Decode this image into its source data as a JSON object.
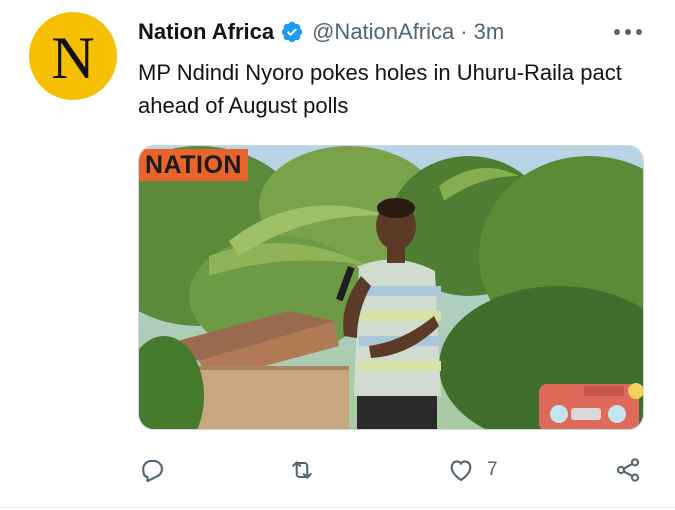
{
  "tweet": {
    "avatar_letter": "N",
    "display_name": "Nation Africa",
    "handle": "@NationAfrica",
    "separator": "·",
    "time": "3m",
    "text": "MP Ndindi Nyoro pokes holes in Uhuru-Raila pact ahead of August polls",
    "media": {
      "watermark": "NATION"
    },
    "actions": {
      "reply": {
        "icon": "reply-icon",
        "count": ""
      },
      "retweet": {
        "icon": "retweet-icon",
        "count": ""
      },
      "like": {
        "icon": "heart-icon",
        "count": "7"
      },
      "share": {
        "icon": "share-icon",
        "count": ""
      }
    }
  },
  "colors": {
    "avatar_bg": "#f6c000",
    "verified": "#1d9bf0",
    "secondary_text": "#536471",
    "watermark_bg": "#e8642a"
  }
}
